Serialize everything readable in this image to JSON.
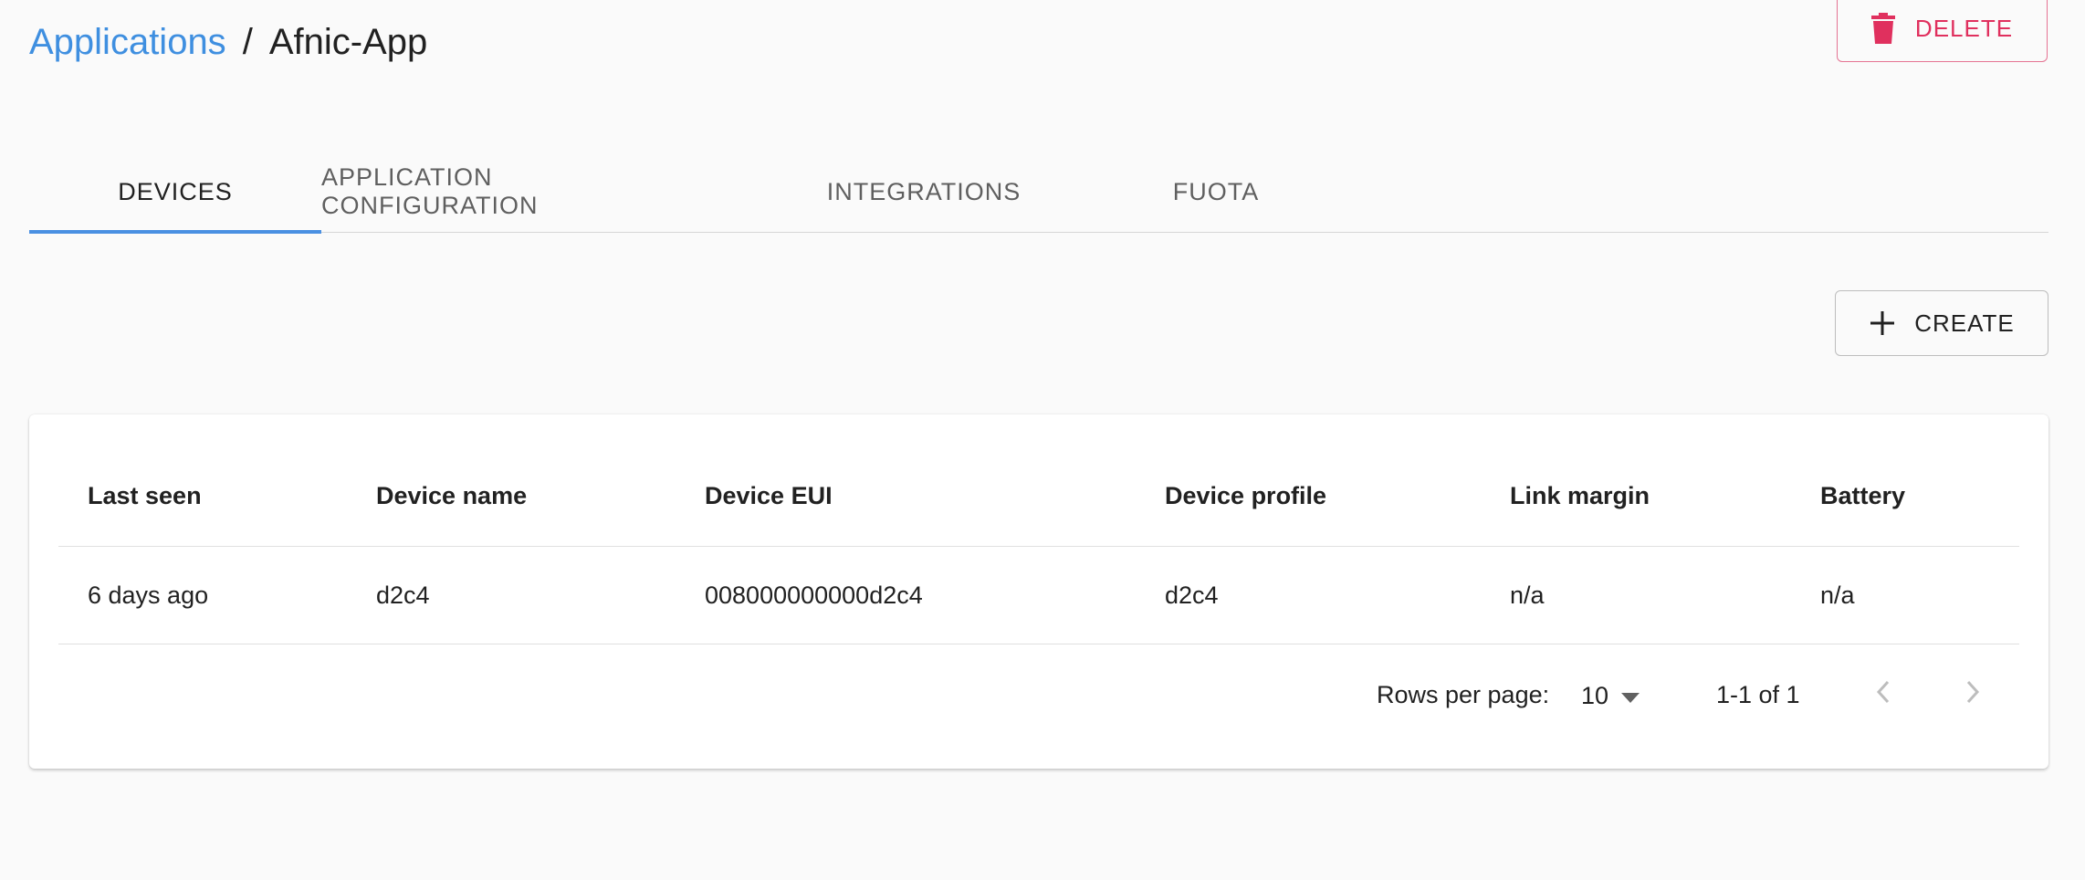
{
  "header": {
    "breadcrumb_root": "Applications",
    "breadcrumb_separator": "/",
    "breadcrumb_current": "Afnic-App",
    "delete_label": "DELETE"
  },
  "tabs": [
    {
      "label": "DEVICES",
      "active": true
    },
    {
      "label": "APPLICATION CONFIGURATION",
      "active": false
    },
    {
      "label": "INTEGRATIONS",
      "active": false
    },
    {
      "label": "FUOTA",
      "active": false
    }
  ],
  "toolbar": {
    "create_label": "CREATE"
  },
  "table": {
    "columns": [
      "Last seen",
      "Device name",
      "Device EUI",
      "Device profile",
      "Link margin",
      "Battery"
    ],
    "rows": [
      {
        "last_seen": "6 days ago",
        "device_name": "d2c4",
        "device_eui": "008000000000d2c4",
        "device_profile": "d2c4",
        "link_margin": "n/a",
        "battery": "n/a"
      }
    ]
  },
  "pagination": {
    "rows_per_page_label": "Rows per page:",
    "rows_per_page_value": "10",
    "range_label": "1-1 of 1"
  },
  "colors": {
    "link": "#3f8fe0",
    "delete": "#e0305e",
    "tab_indicator": "#4a90e2",
    "background": "#fafafa"
  },
  "icons": {
    "delete": "trash-icon",
    "create": "plus-icon",
    "dropdown": "caret-down-icon",
    "prev": "chevron-left-icon",
    "next": "chevron-right-icon"
  }
}
